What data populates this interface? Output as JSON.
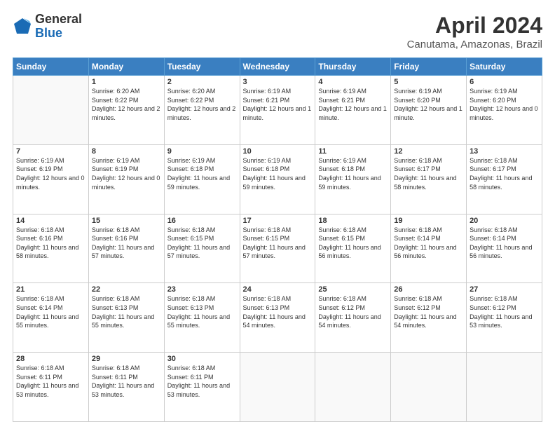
{
  "header": {
    "logo_general": "General",
    "logo_blue": "Blue",
    "month_year": "April 2024",
    "location": "Canutama, Amazonas, Brazil"
  },
  "weekdays": [
    "Sunday",
    "Monday",
    "Tuesday",
    "Wednesday",
    "Thursday",
    "Friday",
    "Saturday"
  ],
  "weeks": [
    [
      {
        "day": "",
        "empty": true
      },
      {
        "day": "1",
        "sunrise": "6:20 AM",
        "sunset": "6:22 PM",
        "daylight": "12 hours and 2 minutes."
      },
      {
        "day": "2",
        "sunrise": "6:20 AM",
        "sunset": "6:22 PM",
        "daylight": "12 hours and 2 minutes."
      },
      {
        "day": "3",
        "sunrise": "6:19 AM",
        "sunset": "6:21 PM",
        "daylight": "12 hours and 1 minute."
      },
      {
        "day": "4",
        "sunrise": "6:19 AM",
        "sunset": "6:21 PM",
        "daylight": "12 hours and 1 minute."
      },
      {
        "day": "5",
        "sunrise": "6:19 AM",
        "sunset": "6:20 PM",
        "daylight": "12 hours and 1 minute."
      },
      {
        "day": "6",
        "sunrise": "6:19 AM",
        "sunset": "6:20 PM",
        "daylight": "12 hours and 0 minutes."
      }
    ],
    [
      {
        "day": "7",
        "sunrise": "6:19 AM",
        "sunset": "6:19 PM",
        "daylight": "12 hours and 0 minutes."
      },
      {
        "day": "8",
        "sunrise": "6:19 AM",
        "sunset": "6:19 PM",
        "daylight": "12 hours and 0 minutes."
      },
      {
        "day": "9",
        "sunrise": "6:19 AM",
        "sunset": "6:18 PM",
        "daylight": "11 hours and 59 minutes."
      },
      {
        "day": "10",
        "sunrise": "6:19 AM",
        "sunset": "6:18 PM",
        "daylight": "11 hours and 59 minutes."
      },
      {
        "day": "11",
        "sunrise": "6:19 AM",
        "sunset": "6:18 PM",
        "daylight": "11 hours and 59 minutes."
      },
      {
        "day": "12",
        "sunrise": "6:18 AM",
        "sunset": "6:17 PM",
        "daylight": "11 hours and 58 minutes."
      },
      {
        "day": "13",
        "sunrise": "6:18 AM",
        "sunset": "6:17 PM",
        "daylight": "11 hours and 58 minutes."
      }
    ],
    [
      {
        "day": "14",
        "sunrise": "6:18 AM",
        "sunset": "6:16 PM",
        "daylight": "11 hours and 58 minutes."
      },
      {
        "day": "15",
        "sunrise": "6:18 AM",
        "sunset": "6:16 PM",
        "daylight": "11 hours and 57 minutes."
      },
      {
        "day": "16",
        "sunrise": "6:18 AM",
        "sunset": "6:15 PM",
        "daylight": "11 hours and 57 minutes."
      },
      {
        "day": "17",
        "sunrise": "6:18 AM",
        "sunset": "6:15 PM",
        "daylight": "11 hours and 57 minutes."
      },
      {
        "day": "18",
        "sunrise": "6:18 AM",
        "sunset": "6:15 PM",
        "daylight": "11 hours and 56 minutes."
      },
      {
        "day": "19",
        "sunrise": "6:18 AM",
        "sunset": "6:14 PM",
        "daylight": "11 hours and 56 minutes."
      },
      {
        "day": "20",
        "sunrise": "6:18 AM",
        "sunset": "6:14 PM",
        "daylight": "11 hours and 56 minutes."
      }
    ],
    [
      {
        "day": "21",
        "sunrise": "6:18 AM",
        "sunset": "6:14 PM",
        "daylight": "11 hours and 55 minutes."
      },
      {
        "day": "22",
        "sunrise": "6:18 AM",
        "sunset": "6:13 PM",
        "daylight": "11 hours and 55 minutes."
      },
      {
        "day": "23",
        "sunrise": "6:18 AM",
        "sunset": "6:13 PM",
        "daylight": "11 hours and 55 minutes."
      },
      {
        "day": "24",
        "sunrise": "6:18 AM",
        "sunset": "6:13 PM",
        "daylight": "11 hours and 54 minutes."
      },
      {
        "day": "25",
        "sunrise": "6:18 AM",
        "sunset": "6:12 PM",
        "daylight": "11 hours and 54 minutes."
      },
      {
        "day": "26",
        "sunrise": "6:18 AM",
        "sunset": "6:12 PM",
        "daylight": "11 hours and 54 minutes."
      },
      {
        "day": "27",
        "sunrise": "6:18 AM",
        "sunset": "6:12 PM",
        "daylight": "11 hours and 53 minutes."
      }
    ],
    [
      {
        "day": "28",
        "sunrise": "6:18 AM",
        "sunset": "6:11 PM",
        "daylight": "11 hours and 53 minutes."
      },
      {
        "day": "29",
        "sunrise": "6:18 AM",
        "sunset": "6:11 PM",
        "daylight": "11 hours and 53 minutes."
      },
      {
        "day": "30",
        "sunrise": "6:18 AM",
        "sunset": "6:11 PM",
        "daylight": "11 hours and 53 minutes."
      },
      {
        "day": "",
        "empty": true
      },
      {
        "day": "",
        "empty": true
      },
      {
        "day": "",
        "empty": true
      },
      {
        "day": "",
        "empty": true
      }
    ]
  ]
}
